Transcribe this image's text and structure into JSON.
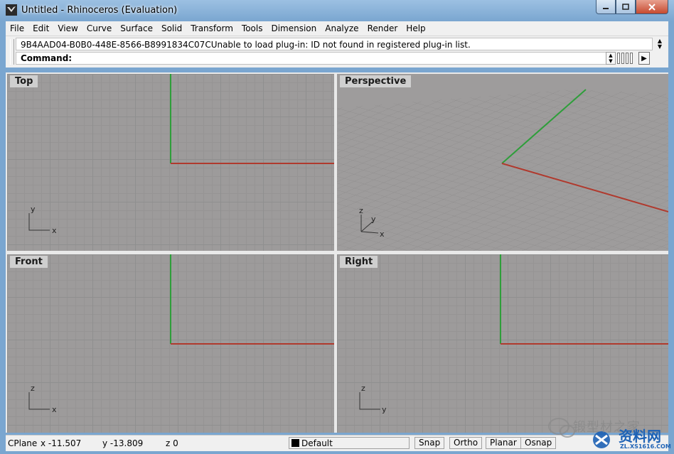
{
  "window": {
    "title": "Untitled - Rhinoceros (Evaluation)"
  },
  "menu": [
    "File",
    "Edit",
    "View",
    "Curve",
    "Surface",
    "Solid",
    "Transform",
    "Tools",
    "Dimension",
    "Analyze",
    "Render",
    "Help"
  ],
  "command": {
    "history": "9B4AAD04-B0B0-448E-8566-B8991834C07CUnable to load plug-in: ID not found in registered plug-in list.",
    "prompt": "Command:",
    "value": ""
  },
  "viewports": {
    "top": {
      "label": "Top",
      "axis_a": "y",
      "axis_b": "x"
    },
    "perspective": {
      "label": "Perspective",
      "axis_z": "z",
      "axis_y": "y",
      "axis_x": "x"
    },
    "front": {
      "label": "Front",
      "axis_a": "z",
      "axis_b": "x"
    },
    "right": {
      "label": "Right",
      "axis_a": "z",
      "axis_b": "y"
    }
  },
  "status": {
    "cplane": "CPlane",
    "x": "x -11.507",
    "y": "y -13.809",
    "z": "z 0",
    "layer": "Default",
    "snap": "Snap",
    "ortho": "Ortho",
    "planar": "Planar",
    "osnap": "Osnap"
  },
  "watermark": {
    "text": "锻型材之家",
    "brand": "资料网",
    "url": "ZL.XS1616.COM"
  },
  "colors": {
    "x_axis": "#b03a2e",
    "y_axis": "#2e9e3a",
    "viewport_bg": "#9d9b9b"
  }
}
